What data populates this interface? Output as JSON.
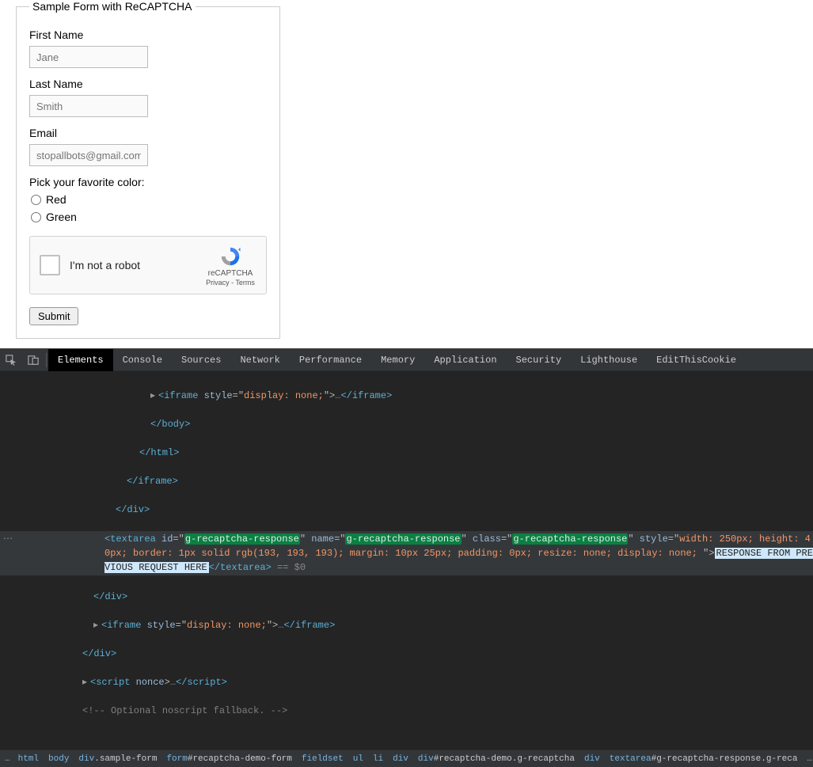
{
  "form": {
    "legend": "Sample Form with ReCAPTCHA",
    "firstNameLabel": "First Name",
    "firstNamePlaceholder": "Jane",
    "lastNameLabel": "Last Name",
    "lastNamePlaceholder": "Smith",
    "emailLabel": "Email",
    "emailPlaceholder": "stopallbots@gmail.com",
    "colorLabel": "Pick your favorite color:",
    "colorOptions": {
      "red": "Red",
      "green": "Green"
    },
    "submitLabel": "Submit"
  },
  "recaptcha": {
    "label": "I'm not a robot",
    "brand": "reCAPTCHA",
    "terms": "Privacy - Terms"
  },
  "devtools": {
    "tabs": [
      "Elements",
      "Console",
      "Sources",
      "Network",
      "Performance",
      "Memory",
      "Application",
      "Security",
      "Lighthouse",
      "EditThisCookie"
    ],
    "activeTab": "Elements",
    "code": {
      "l1_a": "<iframe ",
      "l1_b": "style",
      "l1_c": "=\"",
      "l1_d": "display: none;",
      "l1_e": "\">",
      "l1_f": "…",
      "l1_g": "</iframe>",
      "l2": "</body>",
      "l3": "</html>",
      "l4": "</iframe>",
      "l5": "</div>",
      "sel_a": "<textarea ",
      "sel_id_k": "id",
      "sel_eq": "=\"",
      "sel_q": "\"",
      "sel_id_v": "g-recaptcha-response",
      "sel_name_k": "name",
      "sel_name_v": "g-recaptcha-response",
      "sel_class_k": "class",
      "sel_class_v": "g-recaptcha-response",
      "sel_style_k": "style",
      "sel_style_v": "width: 250px; height: 40px; border: 1px solid rgb(193, 193, 193); margin: 10px 25px; padding: 0px; resize: none; display: none; ",
      "sel_close": "\">",
      "sel_inner": "RESPONSE FROM PREVIOUS REQUEST HERE",
      "sel_end": "</textarea>",
      "eqdollar": " == $0",
      "l7": "</div>",
      "l8_a": "<iframe ",
      "l8_b": "style",
      "l8_c": "=\"",
      "l8_d": "display: none;",
      "l8_e": "\">",
      "l8_f": "…",
      "l8_g": "</iframe>",
      "l9": "</div>",
      "l10_a": "<script ",
      "l10_b": "nonce",
      "l10_c": ">",
      "l10_d": "…",
      "l10_e": "</script>",
      "l11": "<!-- Optional noscript fallback. -->"
    },
    "breadcrumb": {
      "ell": "…",
      "items": [
        {
          "tag": "html",
          "cls": ""
        },
        {
          "tag": "body",
          "cls": ""
        },
        {
          "tag": "div",
          "cls": ".sample-form"
        },
        {
          "tag": "form",
          "cls": "#recaptcha-demo-form"
        },
        {
          "tag": "fieldset",
          "cls": ""
        },
        {
          "tag": "ul",
          "cls": ""
        },
        {
          "tag": "li",
          "cls": ""
        },
        {
          "tag": "div",
          "cls": ""
        },
        {
          "tag": "div",
          "cls": "#recaptcha-demo.g-recaptcha"
        },
        {
          "tag": "div",
          "cls": ""
        },
        {
          "tag": "textarea",
          "cls": "#g-recaptcha-response.g-reca"
        }
      ],
      "trail": "…"
    }
  }
}
